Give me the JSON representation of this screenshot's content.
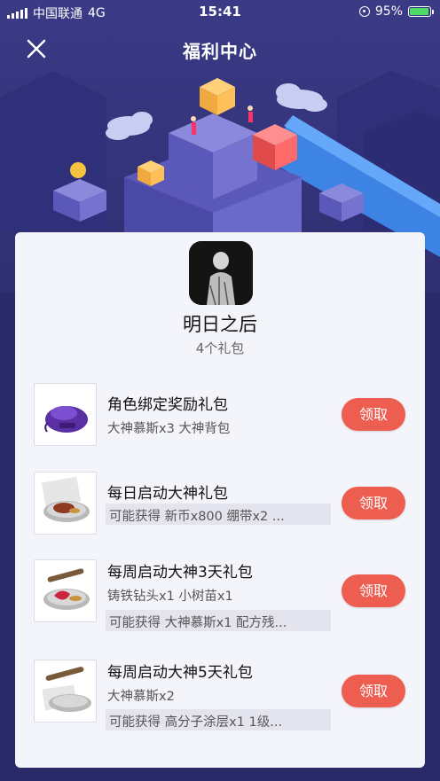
{
  "status_bar": {
    "carrier": "中国联通",
    "network": "4G",
    "time": "15:41",
    "battery": "95%",
    "battery_level": 0.95
  },
  "header": {
    "title": "福利中心",
    "close_icon": "close-icon"
  },
  "game": {
    "name": "明日之后",
    "gift_count": "4个礼包"
  },
  "gifts": [
    {
      "name": "角色绑定奖励礼包",
      "content": "大神慕斯x3 大神背包",
      "possible": "",
      "button": "领取",
      "thumb_icon": "backpack-icon"
    },
    {
      "name": "每日启动大神礼包",
      "content": "",
      "possible": "可能获得 新币x800 绷带x2 ...",
      "button": "领取",
      "thumb_icon": "steak-plate-icon"
    },
    {
      "name": "每周启动大神3天礼包",
      "content": "铸铁钻头x1 小树苗x1",
      "possible": "可能获得 大神慕斯x1 配方残...",
      "button": "领取",
      "thumb_icon": "meat-plate-icon"
    },
    {
      "name": "每周启动大神5天礼包",
      "content": "大神慕斯x2",
      "possible": "可能获得 高分子涂层x1 1级...",
      "button": "领取",
      "thumb_icon": "supplies-plate-icon"
    }
  ],
  "colors": {
    "background": "#2a2a6b",
    "card": "#f4f4fb",
    "claim_button": "#ee5e50",
    "battery": "#4cd964"
  }
}
